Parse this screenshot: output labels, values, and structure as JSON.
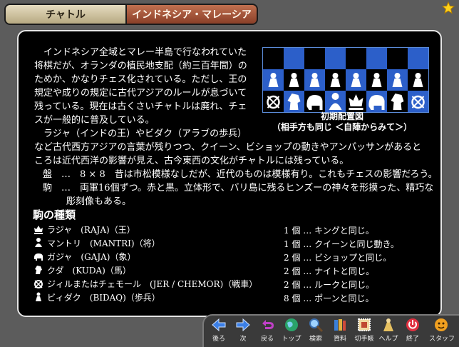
{
  "tabs": {
    "left": "チャトル",
    "right": "インドネシア・マレーシア"
  },
  "intro_lines": [
    "　インドネシア全域とマレー半島で行なわれていた",
    "将棋だが、オランダの植民地支配（約三百年間）の",
    "ためか、かなりチェス化されている。ただし、王の",
    "規定や成りの規定に古代アジアのルールが息づいて",
    "残っている。現在は古くさいチャトルは廃れ、チェ",
    "スが一般的に普及している。",
    "　ラジャ（インドの王）やビダク（アラブの歩兵）"
  ],
  "wide_lines": [
    "など古代西方アジアの言葉が残りつつ、クイーン、ビショップの動きやアンパッサンがあると",
    "ころは近代西洋の影響が見え、古今東西の文化がチャトルには残っている。"
  ],
  "notes": [
    {
      "label": "盤",
      "text": "…　8 × 8　昔は市松模様なしだが、近代のものは模様有り。これもチェスの影響だろう。"
    },
    {
      "label": "駒",
      "text": "…　両軍16個ずつ。赤と黒。立体形で、バリ島に残るヒンズーの神々を形摸った、精巧な",
      "cont": "彫刻像もある。"
    }
  ],
  "caption": {
    "line1": "初期配置図",
    "line2": "（相手方も同じ ＜自陣からみて＞）"
  },
  "pieces_heading": "駒の種類",
  "pieces": [
    {
      "name": "ラジャ　(RAJA)（王）",
      "count": "1 個 … キングと同じ。",
      "icon": "king-icon"
    },
    {
      "name": "マントリ　(MANTRI)（将）",
      "count": "1 個 … クイーンと同じ動き。",
      "icon": "queen-icon"
    },
    {
      "name": "ガジャ　(GAJA)（象）",
      "count": "2 個 … ビショップと同じ。",
      "icon": "elephant-icon"
    },
    {
      "name": "クダ　(KUDA)（馬）",
      "count": "2 個 … ナイトと同じ。",
      "icon": "horse-icon"
    },
    {
      "name": "ジィルまたはチェモール　(JER / CHEMOR)（戦車）",
      "count": "2 個 … ルークと同じ。",
      "icon": "chariot-icon"
    },
    {
      "name": "ビィダク　(BIDAQ)（歩兵）",
      "count": "8 個 … ポーンと同じ。",
      "icon": "pawn-icon"
    }
  ],
  "toolbar": [
    {
      "label": "後ろ",
      "icon": "back-arrow-icon"
    },
    {
      "label": "次",
      "icon": "next-arrow-icon"
    },
    {
      "label": "戻る",
      "icon": "return-icon"
    },
    {
      "label": "トップ",
      "icon": "globe-icon"
    },
    {
      "label": "検索",
      "icon": "magnifier-icon"
    },
    {
      "label": "資料",
      "icon": "books-icon"
    },
    {
      "label": "切手帳",
      "icon": "stamp-icon"
    },
    {
      "label": "ヘルプ",
      "icon": "help-icon"
    },
    {
      "label": "終了",
      "icon": "power-icon"
    },
    {
      "label": "スタッフ",
      "icon": "staff-icon"
    }
  ],
  "colors": {
    "tab_left": "#d8ceb0",
    "tab_right": "#a4553a",
    "board_blue": "#2c5fc9",
    "panel_bg": "#000000"
  }
}
